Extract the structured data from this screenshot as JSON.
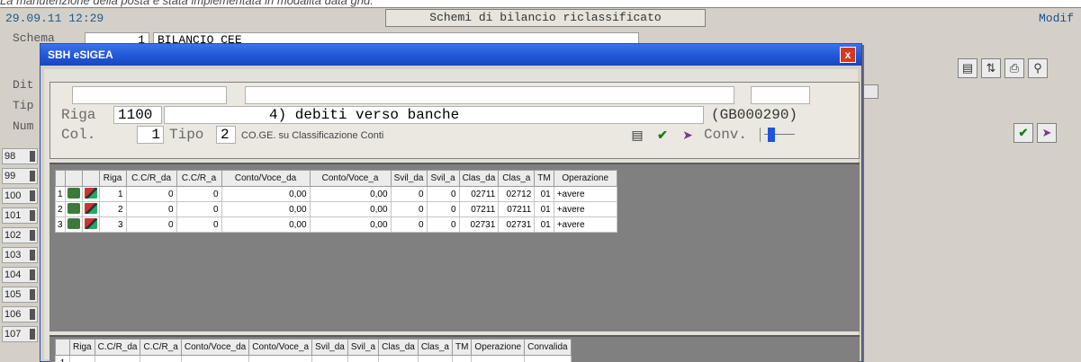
{
  "caption": "La manutenzione della posta è stata implementata in modalità data grid.",
  "app": {
    "datetime": "29.09.11 12:29",
    "title": "Schemi di bilancio riclassificato",
    "mode": "Modif",
    "labels": [
      "Schema",
      "Dit",
      "Tip",
      "Num"
    ],
    "schema_number": "1",
    "schema_name": "BILANCIO CEE",
    "row_numbers": [
      "98",
      "99",
      "100",
      "101",
      "102",
      "103",
      "104",
      "105",
      "106",
      "107"
    ]
  },
  "dialog": {
    "title": "SBH eSIGEA",
    "close": "x",
    "riga_label": "Riga",
    "riga_value": "1100",
    "riga_desc": "4) debiti verso banche",
    "riga_code": "(GB000290)",
    "col_label": "Col.",
    "col_value": "1",
    "tipo_label": "Tipo",
    "tipo_value": "2",
    "tipo_desc": "CO.GE. su Classificazione Conti",
    "conv_label": "Conv."
  },
  "grid1": {
    "headers": [
      "Riga",
      "C.C/R_da",
      "C.C/R_a",
      "Conto/Voce_da",
      "Conto/Voce_a",
      "Svil_da",
      "Svil_a",
      "Clas_da",
      "Clas_a",
      "TM",
      "Operazione"
    ],
    "rows": [
      {
        "n": "1",
        "riga": "1",
        "ccr_da": "0",
        "ccr_a": "0",
        "cv_da": "0,00",
        "cv_a": "0,00",
        "svil_da": "0",
        "svil_a": "0",
        "clas_da": "02711",
        "clas_a": "02712",
        "tm": "01",
        "op": "+avere"
      },
      {
        "n": "2",
        "riga": "2",
        "ccr_da": "0",
        "ccr_a": "0",
        "cv_da": "0,00",
        "cv_a": "0,00",
        "svil_da": "0",
        "svil_a": "0",
        "clas_da": "07211",
        "clas_a": "07211",
        "tm": "01",
        "op": "+avere"
      },
      {
        "n": "3",
        "riga": "3",
        "ccr_da": "0",
        "ccr_a": "0",
        "cv_da": "0,00",
        "cv_a": "0,00",
        "svil_da": "0",
        "svil_a": "0",
        "clas_da": "02731",
        "clas_a": "02731",
        "tm": "01",
        "op": "+avere"
      }
    ]
  },
  "grid2": {
    "headers": [
      "Riga",
      "C.C/R_da",
      "C.C/R_a",
      "Conto/Voce_da",
      "Conto/Voce_a",
      "Svil_da",
      "Svil_a",
      "Clas_da",
      "Clas_a",
      "TM",
      "Operazione",
      "Convalida"
    ],
    "first_row": "1"
  },
  "colors": {
    "title_bar": "#1f55d6",
    "grid_bg": "#808080",
    "accent_date": "#1a5a8a"
  }
}
